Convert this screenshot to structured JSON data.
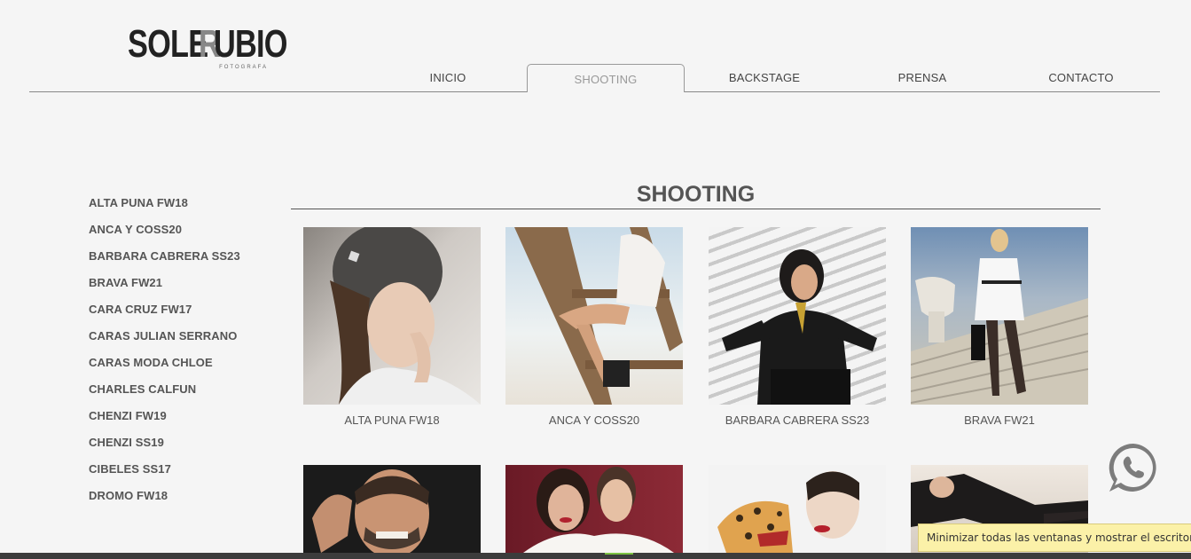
{
  "logo": {
    "word_a": "SOLE",
    "word_b_r": "R",
    "word_b_rest": "UBIO",
    "tagline": "FOTOGRAFA"
  },
  "nav": {
    "items": [
      {
        "label": "INICIO"
      },
      {
        "label": "SHOOTING"
      },
      {
        "label": "BACKSTAGE"
      },
      {
        "label": "PRENSA"
      },
      {
        "label": "CONTACTO"
      }
    ],
    "active": "SHOOTING"
  },
  "sidebar": {
    "items": [
      {
        "label": "ALTA PUNA FW18"
      },
      {
        "label": "ANCA Y COSS20"
      },
      {
        "label": "BARBARA CABRERA SS23"
      },
      {
        "label": "BRAVA FW21"
      },
      {
        "label": "CARA CRUZ FW17"
      },
      {
        "label": "CARAS JULIAN SERRANO"
      },
      {
        "label": "CARAS MODA CHLOE"
      },
      {
        "label": "CHARLES CALFUN"
      },
      {
        "label": "CHENZI FW19"
      },
      {
        "label": "CHENZI SS19"
      },
      {
        "label": "CIBELES SS17"
      },
      {
        "label": "DROMO FW18"
      }
    ]
  },
  "main": {
    "title": "SHOOTING",
    "gallery": [
      {
        "caption": "ALTA PUNA FW18"
      },
      {
        "caption": "ANCA Y COSS20"
      },
      {
        "caption": "BARBARA CABRERA SS23"
      },
      {
        "caption": "BRAVA FW21"
      },
      {
        "caption": ""
      },
      {
        "caption": ""
      },
      {
        "caption": ""
      },
      {
        "caption": ""
      }
    ]
  },
  "tooltip": {
    "text": "Minimizar todas las ventanas y mostrar el escritorio"
  },
  "colors": {
    "background": "#f5f5f5",
    "text": "#555555",
    "whatsapp": "#7a7a7a",
    "tooltip": "#fbf1a8"
  }
}
